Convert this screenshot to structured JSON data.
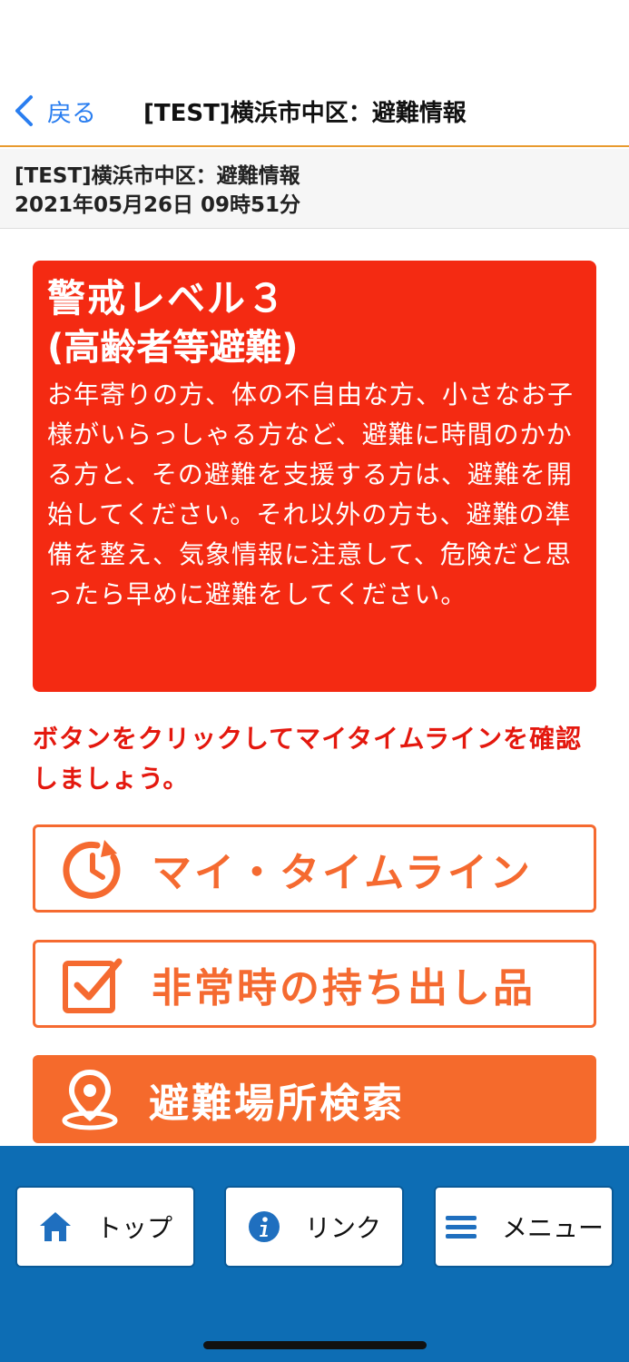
{
  "nav": {
    "back_label": "戻る",
    "title": "[TEST]横浜市中区：避難情報"
  },
  "info": {
    "title": "[TEST]横浜市中区：避難情報",
    "datetime": "2021年05月26日 09時51分"
  },
  "alert": {
    "level": "警戒レベル３",
    "subtitle": "(高齢者等避難)",
    "body": "お年寄りの方、体の不自由な方、小さなお子様がいらっしゃる方など、避難に時間のかかる方と、その避難を支援する方は、避難を開始してください。それ以外の方も、避難の準備を整え、気象情報に注意して、危険だと思ったら早めに避難をしてください。",
    "color": "#f42a12"
  },
  "instruction": "ボタンをクリックしてマイタイムラインを確認しましょう。",
  "actions": [
    {
      "label": "マイ・タイムライン",
      "icon": "timeline-icon",
      "style": "outline"
    },
    {
      "label": "非常時の持ち出し品",
      "icon": "checkbox-icon",
      "style": "outline"
    },
    {
      "label": "避難場所検索",
      "icon": "location-pin-icon",
      "style": "filled"
    }
  ],
  "accent_color": "#f56a30",
  "bottom_nav": {
    "background": "#0d6db4",
    "items": [
      {
        "label": "トップ",
        "icon": "home-icon"
      },
      {
        "label": "リンク",
        "icon": "info-icon"
      },
      {
        "label": "メニュー",
        "icon": "hamburger-icon"
      }
    ]
  }
}
